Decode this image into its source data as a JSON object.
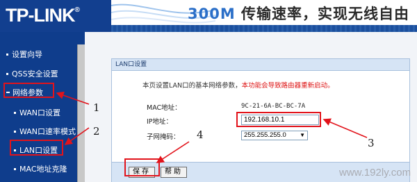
{
  "header": {
    "logo": "TP-LINK",
    "logo_reg": "®",
    "banner_prefix": "300M",
    "banner_text": "传输速率，实现无线自由"
  },
  "sidebar": {
    "items": [
      {
        "label": "设置向导"
      },
      {
        "label": "QSS安全设置"
      },
      {
        "label": "网络参数"
      },
      {
        "label": "WAN口设置"
      },
      {
        "label": "WAN口速率模式"
      },
      {
        "label": "LAN口设置"
      },
      {
        "label": "MAC地址克隆"
      }
    ]
  },
  "panel": {
    "title": "LAN口设置",
    "description": "本页设置LAN口的基本网络参数，",
    "warning": "本功能会导致路由器重新启动。",
    "mac_label": "MAC地址：",
    "mac_value": "9C-21-6A-BC-BC-7A",
    "ip_label": "IP地址：",
    "ip_value": "192.168.10.1",
    "mask_label": "子网掩码：",
    "mask_value": "255.255.255.0",
    "save_label": "保存",
    "help_label": "帮助"
  },
  "annotations": {
    "n1": "1",
    "n2": "2",
    "n3": "3",
    "n4": "4",
    "color": "#e2131b"
  },
  "watermark": "www.192ly.com"
}
